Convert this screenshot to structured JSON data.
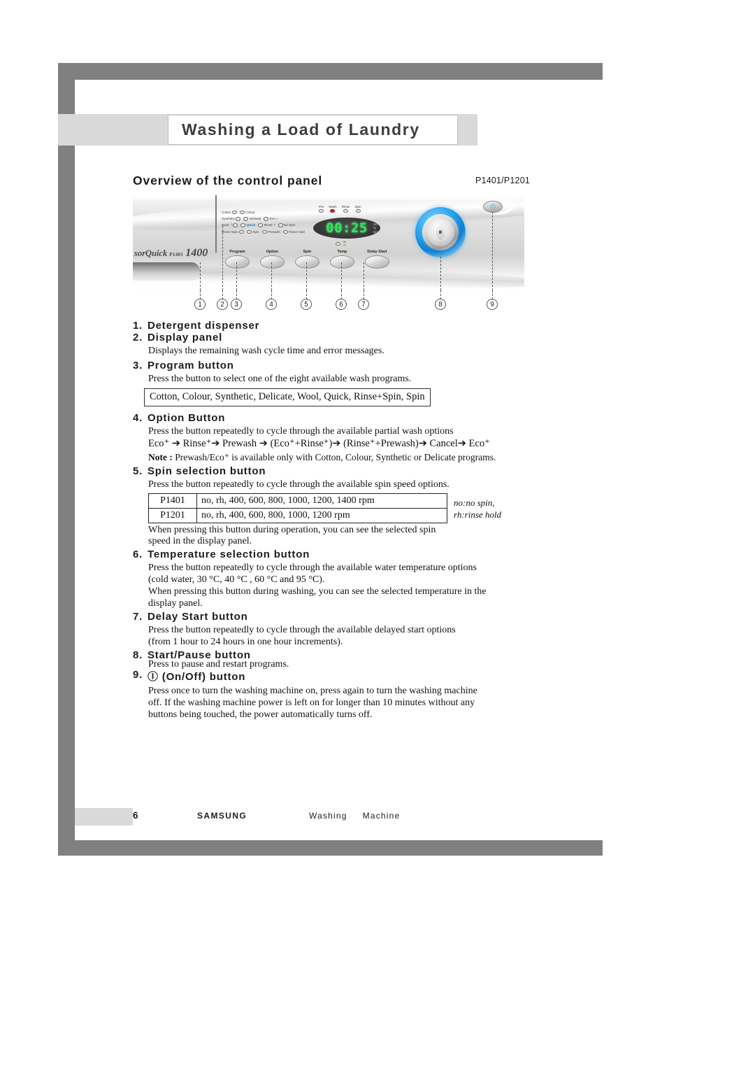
{
  "chapter_title": "Washing a Load of Laundry",
  "section_heading": "Overview of the control panel",
  "model_label": "P1401/P1201",
  "illustration": {
    "brand_prefix": "sor",
    "brand_name": "Quick",
    "brand_model_small": "P1401",
    "brand_model_big": "1400",
    "indicators": [
      [
        "Cotton",
        "Colour"
      ],
      [
        "Synthetic",
        "Delicate",
        "Eco +"
      ],
      [
        "Wool",
        "Quick",
        "Rinse +",
        "No Spin"
      ],
      [
        "Rinse+Spin",
        "Spin",
        "Prewash",
        "Rinse Hold"
      ]
    ],
    "status_leds": [
      "Pre",
      "Wash",
      "Rinse",
      "Spin"
    ],
    "display_value": "00:25",
    "display_units": [
      "min",
      "℃",
      "rpm"
    ],
    "buttons": [
      "Program",
      "Option",
      "Spin",
      "Temp",
      "Delay Start"
    ],
    "power_glyph": "⏻",
    "callouts": [
      "1",
      "2",
      "3",
      "4",
      "5",
      "6",
      "7",
      "8",
      "9"
    ]
  },
  "items": [
    {
      "num": "1.",
      "title": "Detergent dispenser",
      "body": []
    },
    {
      "num": "2.",
      "title": "Display panel",
      "body": [
        "Displays the remaining wash cycle time and error messages."
      ]
    },
    {
      "num": "3.",
      "title": "Program button",
      "body": [
        "Press the button to select one of the eight available wash programs."
      ],
      "boxed": "Cotton, Colour, Synthetic, Delicate, Wool, Quick, Rinse+Spin, Spin"
    },
    {
      "num": "4.",
      "title": "Option Button",
      "body": [
        "Press the button repeatedly to cycle through the available partial wash options"
      ],
      "arrow_sequence": "Eco⁺ ➔ Rinse⁺➔ Prewash ➔ (Eco⁺+Rinse⁺)➔ (Rinse⁺+Prewash)➔ Cancel➔ Eco⁺",
      "note_label": "Note :",
      "note_text": "Prewash/Eco⁺ is available only with Cotton, Colour, Synthetic or Delicate programs."
    },
    {
      "num": "5.",
      "title": "Spin selection button",
      "body": [
        "Press the button repeatedly to cycle through the available spin speed options."
      ],
      "table": {
        "rows": [
          {
            "model": "P1401",
            "values": "no,  rh,  400,  600,  800,  1000,  1200,  1400 rpm"
          },
          {
            "model": "P1201",
            "values": "no,  rh,  400,  600,  800,  1000,  1200 rpm"
          }
        ]
      },
      "legend": [
        "no:no spin,",
        "rh:rinse hold"
      ],
      "after": [
        "When pressing this button during operation, you can see the selected spin",
        "speed in the display panel."
      ]
    },
    {
      "num": "6.",
      "title": "Temperature selection button",
      "body": [
        "Press the button repeatedly to cycle through the available water temperature options",
        "(cold water, 30 °C, 40 °C , 60 °C and 95 °C).",
        "When pressing this button during washing, you can see the selected temperature in the",
        "display panel."
      ]
    },
    {
      "num": "7.",
      "title": "Delay Start button",
      "body": [
        "Press the button repeatedly to cycle through the available delayed start options",
        "(from 1 hour to 24 hours in one hour increments)."
      ]
    },
    {
      "num": "8.",
      "title": "Start/Pause button",
      "body": [
        "Press to pause and restart programs."
      ]
    },
    {
      "num": "9.",
      "title": "Ⓘ (On/Off) button",
      "body": [
        "Press once to turn the washing machine on, press again to turn the washing machine",
        "off. If the washing machine power is left on for longer than 10 minutes without any",
        "buttons being touched, the power automatically turns off."
      ]
    }
  ],
  "footer": {
    "page_number": "6",
    "brand": "SAMSUNG",
    "doc_word1": "Washing",
    "doc_word2": "Machine"
  }
}
